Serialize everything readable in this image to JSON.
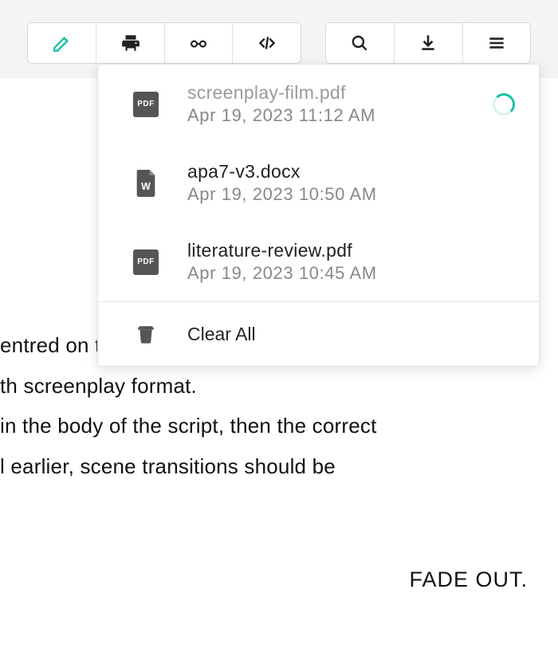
{
  "colors": {
    "accent": "#17c3a5"
  },
  "toolbar": {
    "group1": [
      "edit",
      "print",
      "reader",
      "code"
    ],
    "group2": [
      "search",
      "download",
      "menu"
    ]
  },
  "downloads": {
    "items": [
      {
        "name": "screenplay-film.pdf",
        "date": "Apr 19, 2023 11:12 AM",
        "type": "pdf",
        "loading": true
      },
      {
        "name": "apa7-v3.docx",
        "date": "Apr 19, 2023 10:50 AM",
        "type": "docx",
        "loading": false
      },
      {
        "name": "literature-review.pdf",
        "date": "Apr 19, 2023 10:45 AM",
        "type": "pdf",
        "loading": false
      }
    ],
    "clear_label": "Clear All"
  },
  "document": {
    "lines": [
      "entred on the page.",
      "th screenplay format.",
      " in the body of the script, then the correct",
      "l earlier, scene transitions should be"
    ],
    "fadeout": "FADE OUT."
  }
}
